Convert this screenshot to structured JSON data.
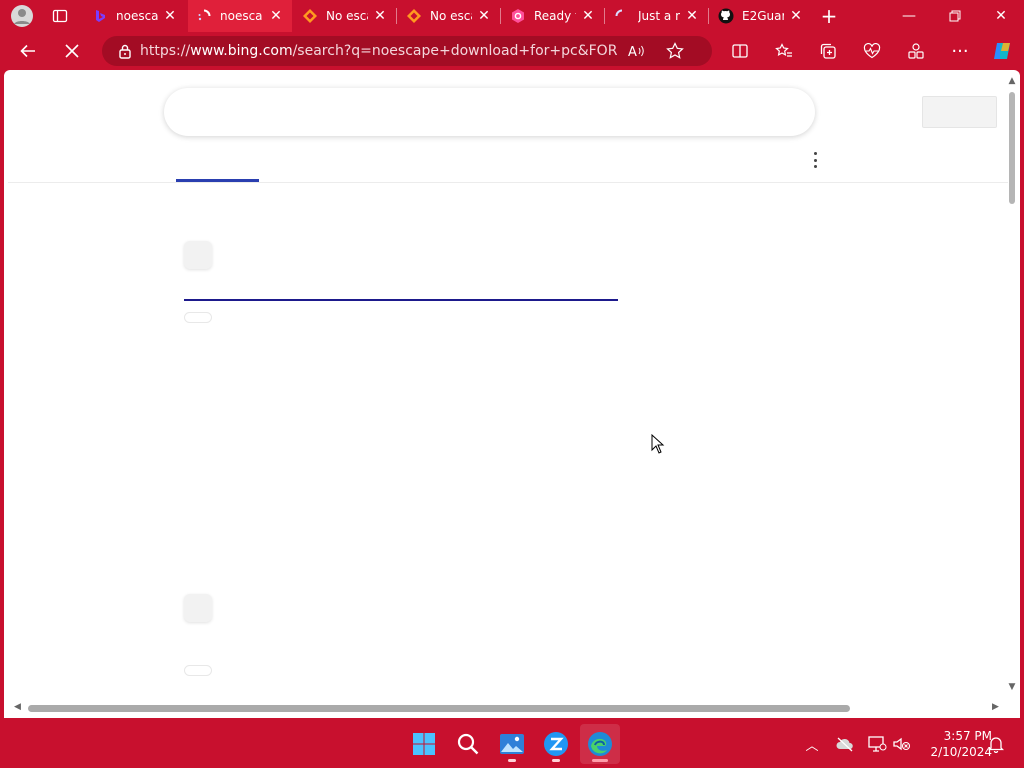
{
  "tabs": [
    {
      "title": "noescap",
      "icon": "bing-icon"
    },
    {
      "title": "noescap",
      "icon": "loading-spinner-icon",
      "active": true
    },
    {
      "title": "No esca",
      "icon": "orange-diamond-icon"
    },
    {
      "title": "No esca",
      "icon": "orange-diamond-icon"
    },
    {
      "title": "Ready t",
      "icon": "pink-hexagon-icon"
    },
    {
      "title": "Just a m",
      "icon": "loading-spinner-icon"
    },
    {
      "title": "E2Guar",
      "icon": "github-icon"
    }
  ],
  "address": {
    "scheme": "https://",
    "host": "www.bing.com",
    "path": "/search?q=noescape+download+for+pc&FORM=QS..."
  },
  "clock": {
    "time": "3:57 PM",
    "date": "2/10/2024"
  },
  "colors": {
    "accent": "#c8102e",
    "active_tab": "#e0203a",
    "loader": "#1d1a8c",
    "scope": "#2a3fb0"
  }
}
